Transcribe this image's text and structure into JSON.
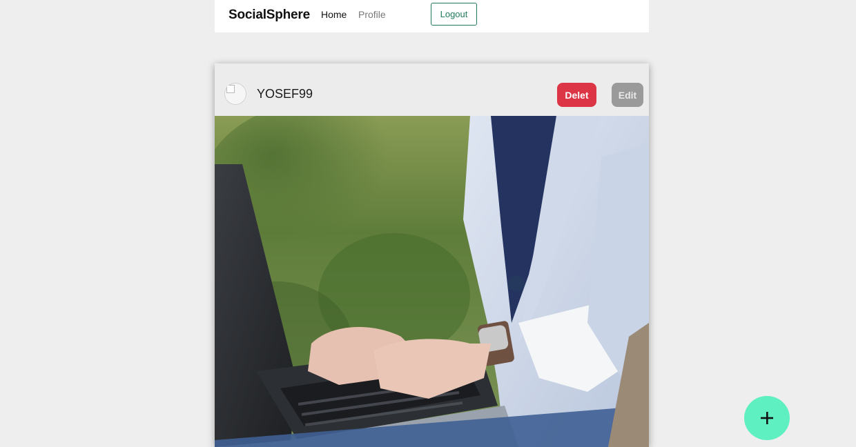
{
  "navbar": {
    "brand": "SocialSphere",
    "links": [
      {
        "label": "Home"
      },
      {
        "label": "Profile"
      }
    ],
    "logout_label": "Logout"
  },
  "post": {
    "username": "YOSEF99",
    "delete_label": "Delet",
    "edit_label": "Edit",
    "image_alt": "Person typing on a laptop outdoors"
  },
  "fab": {
    "icon": "plus-icon"
  },
  "colors": {
    "background": "#eeeeee",
    "logout_border": "#1f7a5b",
    "delete": "#dc3545",
    "edit": "#9a9a9a",
    "fab": "#5ef0c0"
  }
}
